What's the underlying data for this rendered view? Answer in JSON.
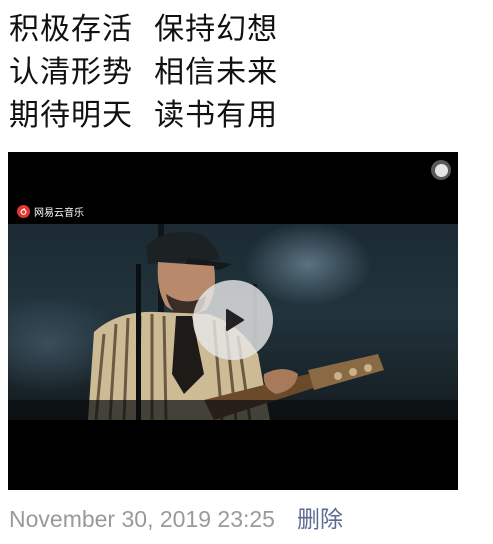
{
  "post": {
    "lines": [
      "积极存活  保持幻想",
      "认清形势  相信未来",
      "期待明天  读书有用"
    ]
  },
  "video": {
    "brand_text": "网易云音乐",
    "play_icon": "play-icon",
    "colors": {
      "brand_red": "#e5362f",
      "background": "#000000"
    }
  },
  "footer": {
    "timestamp": "November 30, 2019 23:25",
    "delete_label": "删除",
    "colors": {
      "timestamp": "#9a9a9a",
      "delete": "#5b6b93"
    }
  }
}
